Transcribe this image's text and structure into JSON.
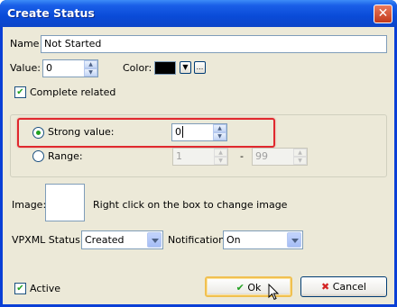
{
  "window": {
    "title": "Create Status",
    "close_symbol": "✕"
  },
  "name": {
    "label": "Name",
    "value": "Not Started"
  },
  "value": {
    "label": "Value:",
    "value": "0"
  },
  "color": {
    "label": "Color:",
    "swatch_hex": "#000000",
    "more_label": "..."
  },
  "complete_related": {
    "label": "Complete related",
    "checked": true
  },
  "strong_value": {
    "label": "Strong value:",
    "value": "0",
    "selected": true
  },
  "range": {
    "label": "Range:",
    "from": "1",
    "separator": "-",
    "to": "99"
  },
  "image": {
    "label": "Image:",
    "hint": "Right click on the box to  change image"
  },
  "vpxml_status": {
    "label": "VPXML Status:",
    "selected": "Created"
  },
  "notification": {
    "label": "Notification:",
    "selected": "On"
  },
  "active": {
    "label": "Active",
    "checked": true
  },
  "buttons": {
    "ok": "Ok",
    "cancel": "Cancel"
  },
  "colors": {
    "highlight": "#e0282e",
    "check": "#21a121",
    "cancel_x": "#d42323"
  }
}
